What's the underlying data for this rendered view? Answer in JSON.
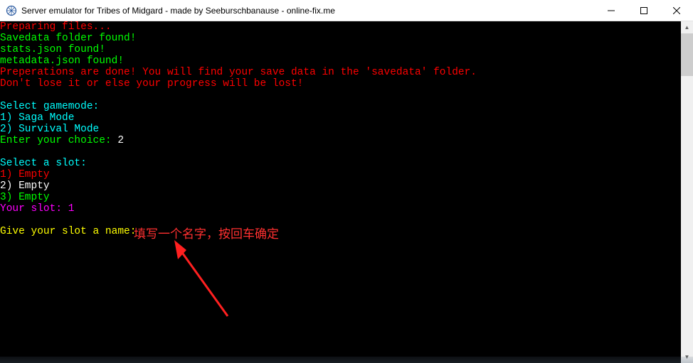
{
  "window": {
    "title": "Server emulator for Tribes of Midgard - made by Seeburschbanause - online-fix.me"
  },
  "console": {
    "lines": [
      {
        "cls": "c-red",
        "text": "Preparing files..."
      },
      {
        "cls": "c-green",
        "text": "Savedata folder found!"
      },
      {
        "cls": "c-green",
        "text": "stats.json found!"
      },
      {
        "cls": "c-green",
        "text": "metadata.json found!"
      },
      {
        "cls": "c-red",
        "text": "Preperations are done! You will find your save data in the 'savedata' folder."
      },
      {
        "cls": "c-red",
        "text": "Don't lose it or else your progress will be lost!"
      },
      {
        "cls": "",
        "text": ""
      },
      {
        "cls": "c-cyan",
        "text": "Select gamemode:"
      },
      {
        "cls": "c-cyan",
        "text": "1) Saga Mode"
      },
      {
        "cls": "c-cyan",
        "text": "2) Survival Mode"
      },
      {
        "segments": [
          {
            "cls": "c-green",
            "text": "Enter your choice: "
          },
          {
            "cls": "c-white",
            "text": "2"
          }
        ]
      },
      {
        "cls": "",
        "text": ""
      },
      {
        "cls": "c-cyan",
        "text": "Select a slot:"
      },
      {
        "cls": "c-red",
        "text": "1) Empty"
      },
      {
        "cls": "c-white",
        "text": "2) Empty"
      },
      {
        "cls": "c-green",
        "text": "3) Empty"
      },
      {
        "cls": "c-magenta",
        "text": "Your slot: 1"
      },
      {
        "cls": "",
        "text": ""
      },
      {
        "cls": "c-yellow",
        "text": "Give your slot a name: "
      }
    ]
  },
  "annotation": {
    "text": "填写一个名字，按回车确定"
  }
}
